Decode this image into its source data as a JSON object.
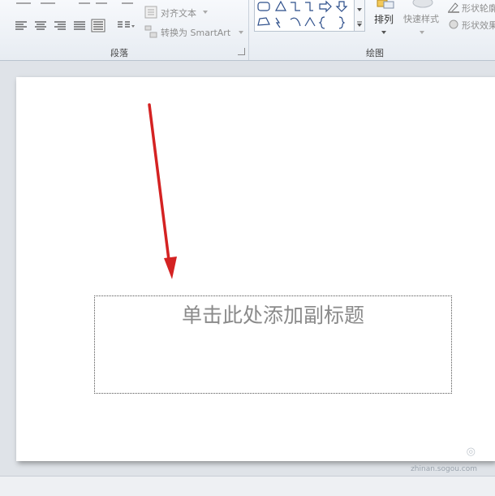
{
  "ribbon": {
    "paragraph_group": {
      "label": "段落",
      "align_text_label": "对齐文本",
      "convert_smartart_label": "转换为 SmartArt"
    },
    "drawing_group": {
      "label": "绘图",
      "arrange_label": "排列",
      "quick_styles_label": "快速样式",
      "shape_outline_label": "形状轮廓",
      "shape_effects_label": "形状效果"
    }
  },
  "slide": {
    "subtitle_placeholder": "单击此处添加副标题"
  },
  "watermark": {
    "text": "zhinan.sogou.com"
  },
  "colors": {
    "arrow": "#d42222",
    "ribbon_bg": "#eef2f7",
    "workspace_bg": "#dfe3e8"
  }
}
